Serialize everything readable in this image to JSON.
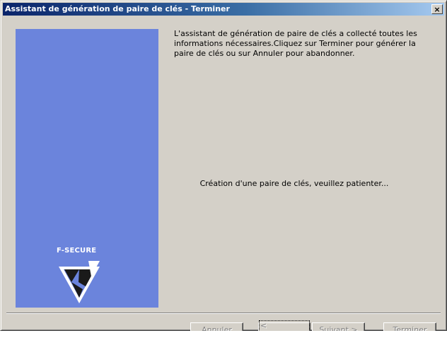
{
  "window": {
    "title": "Assistant de génération de paire de clés - Terminer",
    "close_label": "×"
  },
  "side_panel": {
    "logo_text": "F-SECURE"
  },
  "intro_text": "L'assistant de génération de paire de clés a collecté toutes les informations nécessaires.Cliquez sur Terminer pour générer la paire de clés ou sur Annuler pour abandonner.",
  "status_text": "Création d'une paire de clés, veuillez patienter...",
  "buttons": {
    "cancel": "Annuler",
    "previous": "< Précédent",
    "next": "Suivant >",
    "finish": "Terminer"
  },
  "colors": {
    "title_bar_start": "#0a246a",
    "title_bar_end": "#a6caf0",
    "side_panel": "#6b84dc",
    "window_face": "#d4d0c8"
  },
  "icons": {
    "close": "close-icon",
    "logo": "f-secure-logo-icon"
  }
}
